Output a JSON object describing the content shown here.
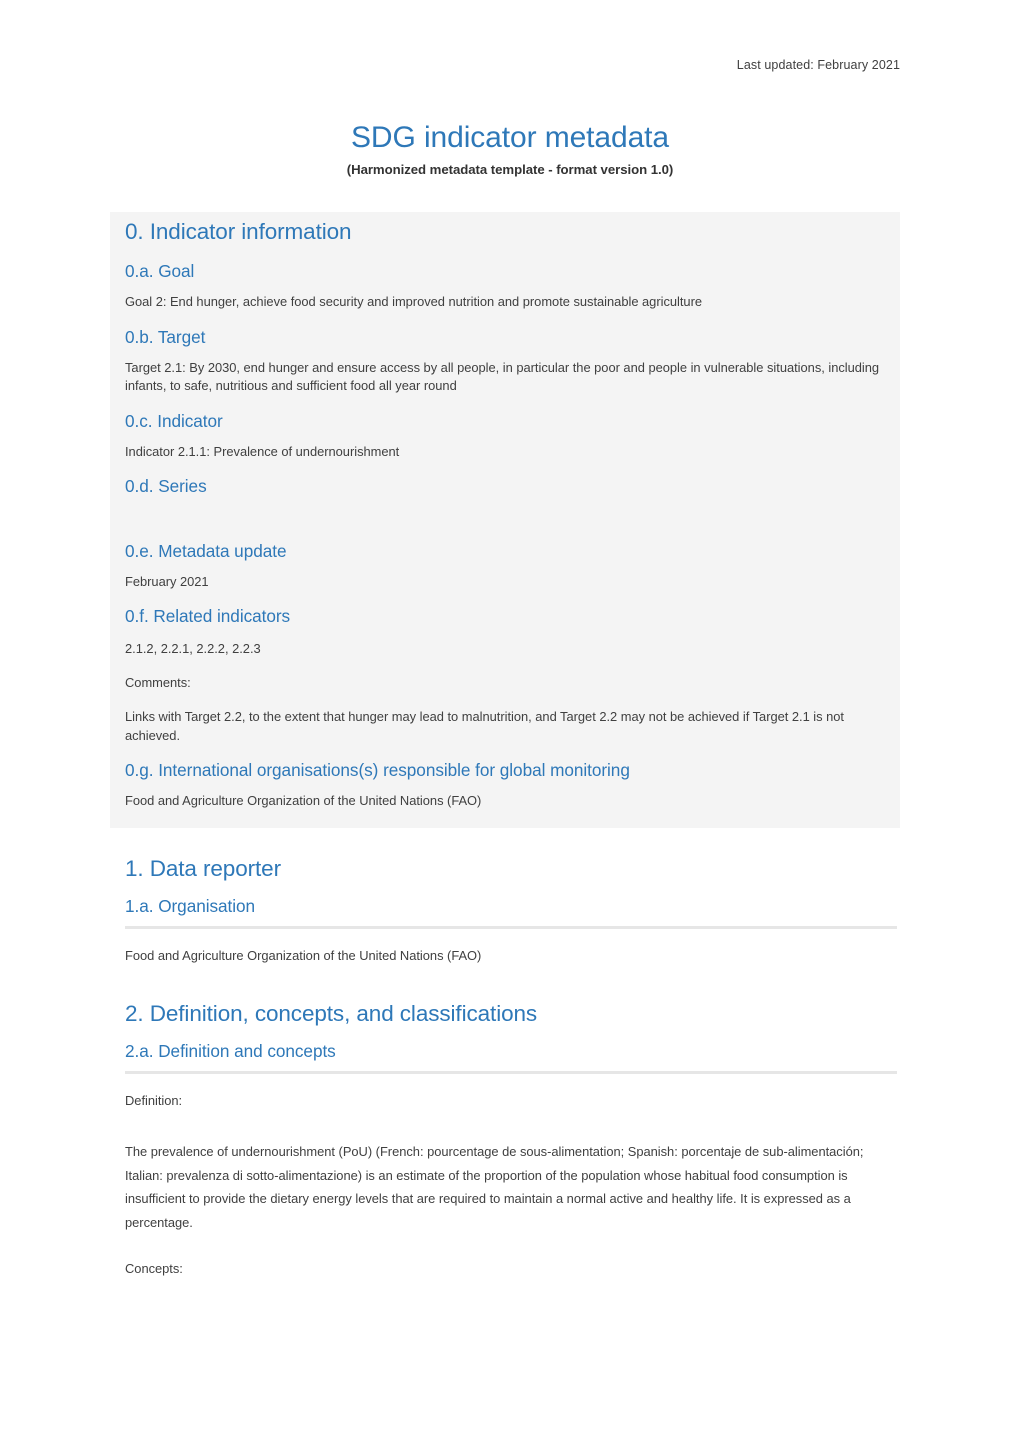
{
  "header": {
    "last_updated": "Last updated: February 2021"
  },
  "title": {
    "main": "SDG indicator metadata",
    "subtitle": "(Harmonized metadata template - format version 1.0)"
  },
  "colors": {
    "heading_blue": "#2e78b8",
    "body_text": "#404040",
    "panel_grey": "#f4f4f4",
    "rule_grey": "#e6e6e6"
  },
  "section0": {
    "heading": "0. Indicator information",
    "goal": {
      "heading": "0.a. Goal",
      "text": "Goal 2: End hunger, achieve food security and improved nutrition and promote sustainable agriculture"
    },
    "target": {
      "heading": "0.b. Target",
      "text": "Target 2.1: By 2030, end hunger and ensure access by all people, in particular the poor and people in vulnerable situations, including infants, to safe, nutritious and sufficient food all year round"
    },
    "indicator": {
      "heading": "0.c. Indicator",
      "text": "Indicator 2.1.1: Prevalence of undernourishment"
    },
    "series": {
      "heading": "0.d. Series",
      "text": ""
    },
    "metadata_update": {
      "heading": "0.e. Metadata update",
      "text": "February 2021"
    },
    "related_indicators": {
      "heading": "0.f. Related indicators",
      "list": "2.1.2, 2.2.1, 2.2.2, 2.2.3",
      "comments_label": "Comments:",
      "comments_text": "Links with Target 2.2, to the extent that hunger may lead to malnutrition, and Target 2.2 may not be achieved if Target 2.1 is not achieved."
    },
    "international_orgs": {
      "heading": "0.g. International organisations(s) responsible for global monitoring",
      "text": "Food and Agriculture Organization of the United Nations (FAO)"
    }
  },
  "section1": {
    "heading": "1. Data reporter",
    "organisation": {
      "heading": "1.a. Organisation",
      "text": "Food and Agriculture Organization of the United Nations (FAO)"
    }
  },
  "section2": {
    "heading": "2. Definition, concepts, and classifications",
    "definition_concepts": {
      "heading": "2.a. Definition and concepts",
      "definition_label": "Definition:",
      "definition_text": "The prevalence of undernourishment (PoU) (French: pourcentage de sous-alimentation; Spanish: porcentaje de sub-alimentación; Italian: prevalenza di sotto-alimentazione) is an estimate of the proportion of the population whose habitual food consumption is insufficient to provide the dietary energy levels that are required to maintain a normal active and healthy life. It is expressed as a percentage.",
      "concepts_label": "Concepts:"
    }
  }
}
